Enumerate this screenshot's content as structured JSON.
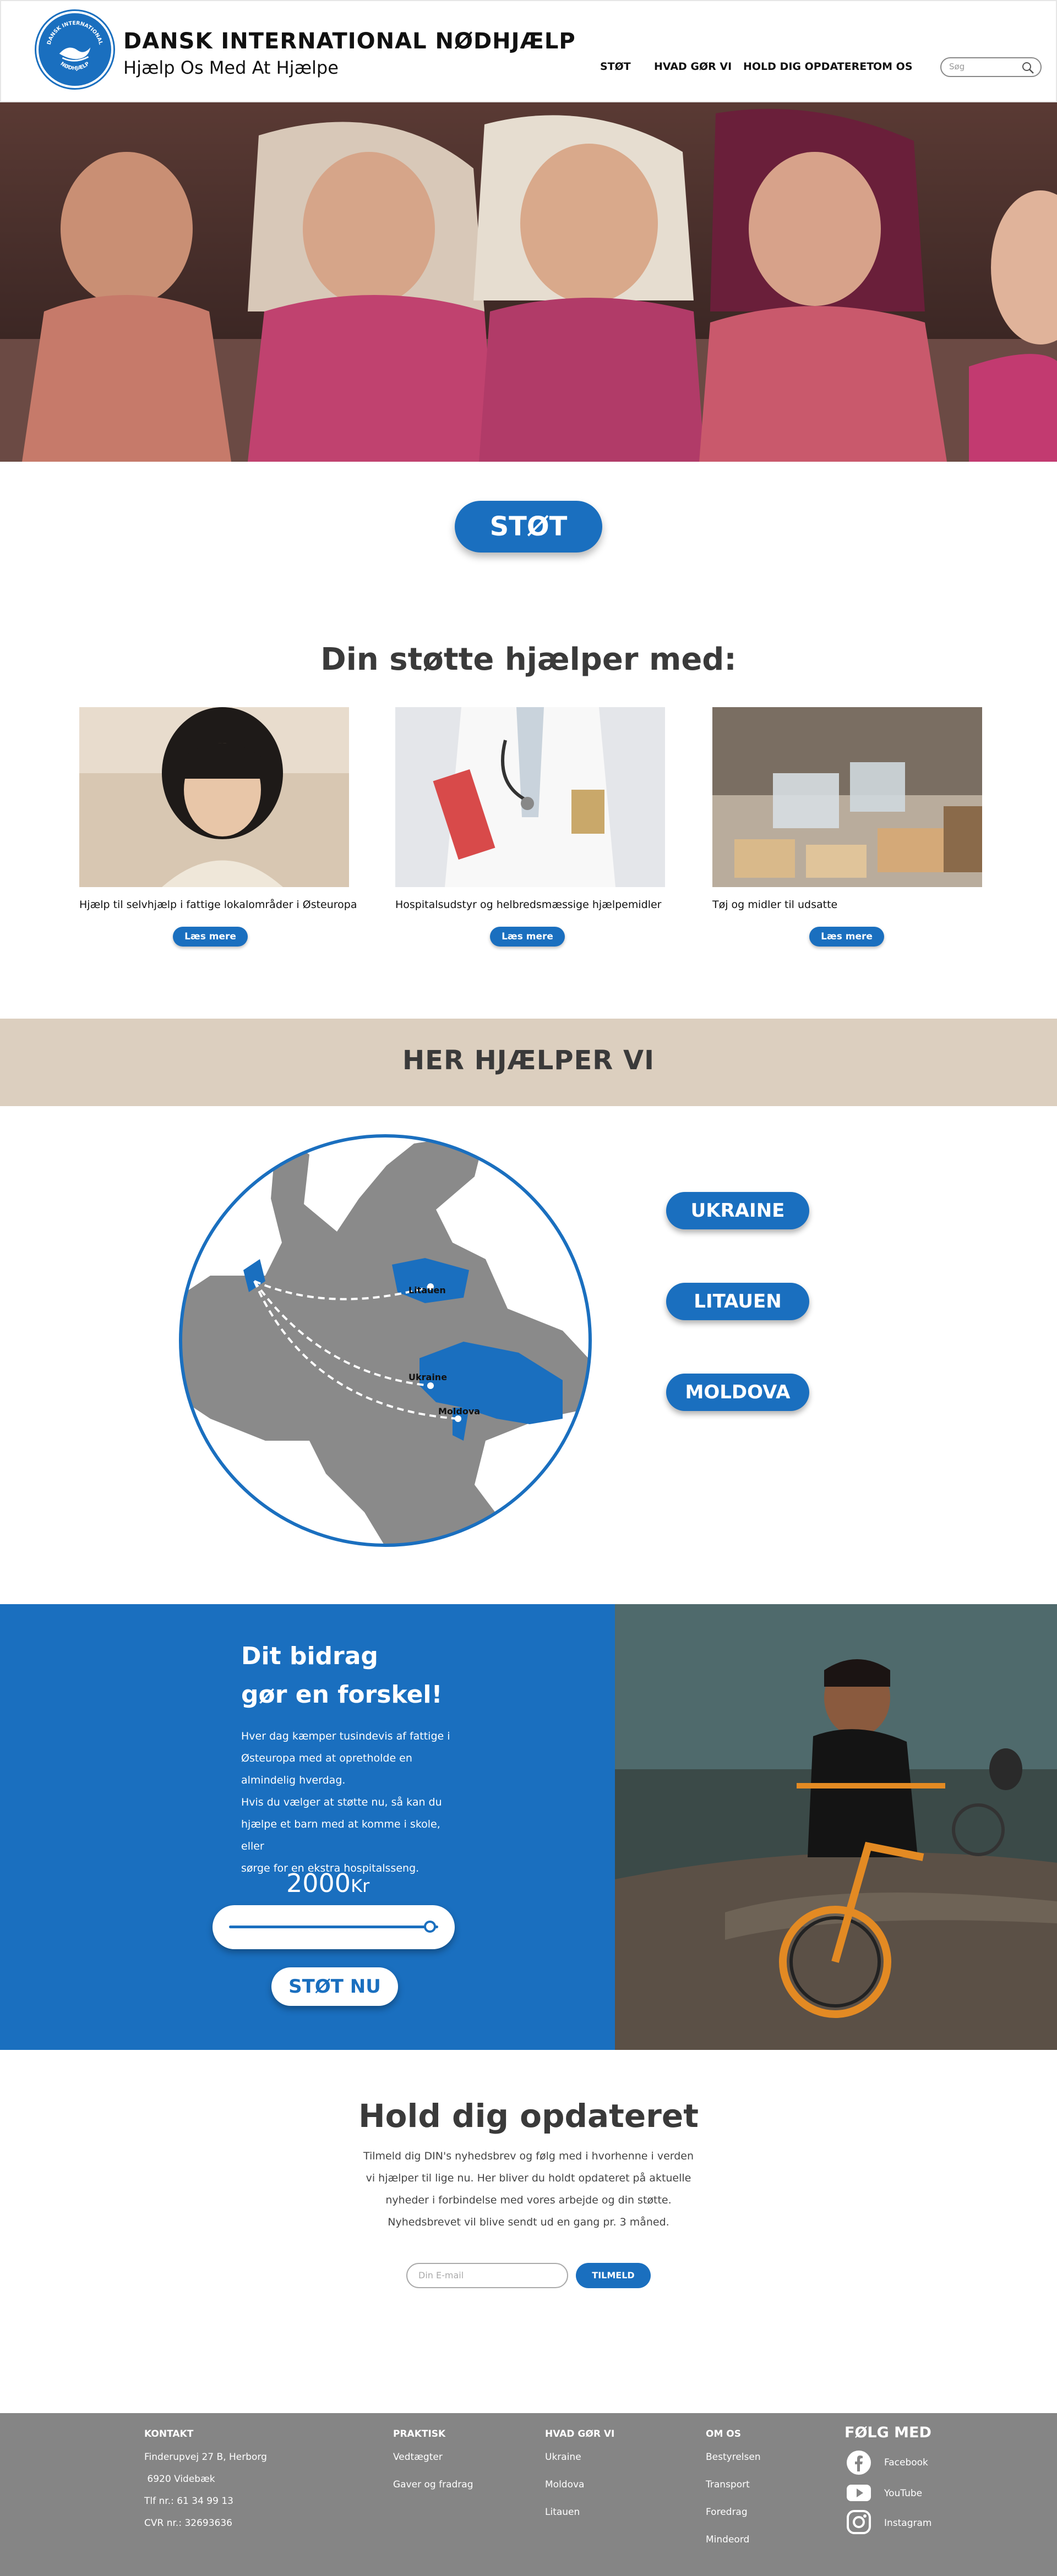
{
  "header": {
    "logo_text_top": "DANSK INTERNATIONAL",
    "logo_text_bottom": "NØDHJÆLP",
    "org_name": "DANSK INTERNATIONAL NØDHJÆLP",
    "tagline": "Hjælp Os Med At Hjælpe",
    "nav": [
      "STØT",
      "HVAD GØR VI",
      "HOLD DIG OPDATERET",
      "OM OS"
    ],
    "search_placeholder": "Søg"
  },
  "hero": {
    "cta_label": "STØT"
  },
  "support": {
    "title": "Din støtte hjælper med:",
    "cards": [
      {
        "text": "Hjælp til selvhjælp i fattige lokalområder i Østeuropa",
        "button": "Læs mere"
      },
      {
        "text": "Hospitalsudstyr og helbredsmæssige hjælpemidler",
        "button": "Læs mere"
      },
      {
        "text": "Tøj og midler til udsatte",
        "button": "Læs mere"
      }
    ]
  },
  "here": {
    "title": "HER HJÆLPER VI",
    "map_labels": [
      "Litauen",
      "Ukraine",
      "Moldova"
    ],
    "countries": [
      "UKRAINE",
      "LITAUEN",
      "MOLDOVA"
    ]
  },
  "donate": {
    "title_line1": "Dit bidrag",
    "title_line2": "gør en forskel!",
    "body": [
      "Hver dag kæmper tusindevis af fattige i",
      "Østeuropa med at opretholde en",
      "almindelig hverdag.",
      "Hvis du vælger at støtte nu, så kan du",
      "hjælpe et barn med at komme i skole, eller",
      "sørge for en ekstra hospitalsseng."
    ],
    "amount": "2000",
    "amount_unit": "Kr",
    "slider_fraction": 0.96,
    "button": "STØT NU"
  },
  "newsletter": {
    "title": "Hold dig opdateret",
    "body": [
      "Tilmeld dig DIN's nyhedsbrev og følg med i hvorhenne i verden",
      "vi hjælper til lige nu. Her bliver du holdt opdateret på aktuelle",
      "nyheder i forbindelse med vores arbejde og din støtte.",
      "Nyhedsbrevet vil blive sendt ud en gang pr. 3 måned."
    ],
    "email_placeholder": "Din E-mail",
    "button": "TILMELD"
  },
  "footer": {
    "kontakt_title": "KONTAKT",
    "kontakt": [
      "Finderupvej 27 B, Herborg",
      " 6920 Videbæk",
      "Tlf nr.: 61 34 99 13",
      "CVR nr.: 32693636"
    ],
    "praktisk_title": "PRAKTISK",
    "praktisk": [
      "Vedtægter",
      "Gaver og fradrag"
    ],
    "hvad_title": "HVAD GØR VI",
    "hvad": [
      "Ukraine",
      "Moldova",
      "Litauen"
    ],
    "omos_title": "OM OS",
    "omos": [
      "Bestyrelsen",
      "Transport",
      "Foredrag",
      "Mindeord"
    ],
    "follow_title": "FØLG MED",
    "social": [
      "Facebook",
      "YouTube",
      "Instagram"
    ]
  },
  "colors": {
    "primary": "#1a6fbf",
    "beige": "#dccfbf",
    "footer": "#858585"
  }
}
